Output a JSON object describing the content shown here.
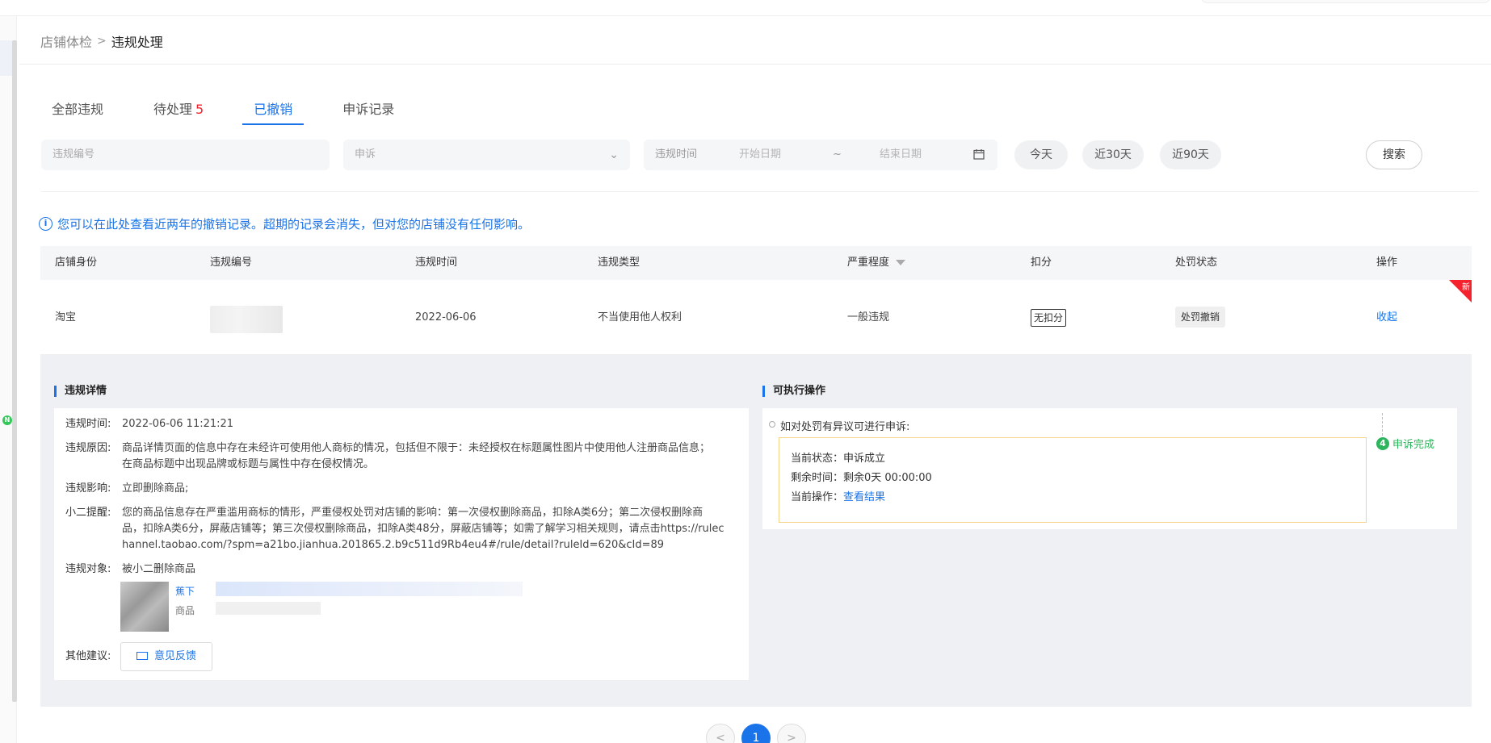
{
  "breadcrumb": {
    "parent": "店铺体检",
    "separator": ">",
    "current": "违规处理"
  },
  "tabs": [
    {
      "label": "全部违规",
      "count": ""
    },
    {
      "label": "待处理",
      "count": "5"
    },
    {
      "label": "已撤销",
      "count": ""
    },
    {
      "label": "申诉记录",
      "count": ""
    }
  ],
  "filters": {
    "id_placeholder": "违规编号",
    "select_value": "申诉",
    "date_label": "违规时间",
    "start_placeholder": "开始日期",
    "tilde": "~",
    "end_placeholder": "结束日期",
    "chip_today": "今天",
    "chip_30": "近30天",
    "chip_90": "近90天",
    "search_label": "搜索"
  },
  "notice": "您可以在此处查看近两年的撤销记录。超期的记录会消失，但对您的店铺没有任何影响。",
  "table": {
    "headers": [
      "店铺身份",
      "违规编号",
      "违规时间",
      "违规类型",
      "严重程度",
      "扣分",
      "处罚状态",
      "操作"
    ],
    "row": {
      "identity": "淘宝",
      "time": "2022-06-06",
      "type": "不当使用他人权利",
      "severity": "一般违规",
      "deduction": "无扣分",
      "status": "处罚撤销",
      "action": "收起",
      "new_badge": "新"
    }
  },
  "detail": {
    "section_title": "违规详情",
    "time_k": "违规时间:",
    "time_v": "2022-06-06 11:21:21",
    "reason_k": "违规原因:",
    "reason_v1": "商品详情页面的信息中存在未经许可使用他人商标的情况，包括但不限于：未经授权在标题属性图片中使用他人注册商品信息；",
    "reason_v2": "在商品标题中出现品牌或标题与属性中存在侵权情况。",
    "impact_k": "违规影响:",
    "impact_v": "立即删除商品;",
    "tip_k": "小二提醒:",
    "tip_v1": "您的商品信息存在严重滥用商标的情形，严重侵权处罚对店铺的影响：第一次侵权删除商品，扣除A类6分；第二次侵权删除商",
    "tip_v2": "品，扣除A类6分，屏蔽店铺等；第三次侵权删除商品，扣除A类48分，屏蔽店铺等；如需了解学习相关规则，请点击https://rulec",
    "tip_v3": "hannel.taobao.com/?spm=a21bo.jianhua.201865.2.b9c511d9Rb4eu4#/rule/detail?ruleId=620&cId=89",
    "target_k": "违规对象:",
    "target_v": "被小二删除商品",
    "item_lbl1": "蕉下",
    "item_lbl2": "商品",
    "other_k": "其他建议:",
    "feedback_label": "意见反馈"
  },
  "actions": {
    "section_title": "可执行操作",
    "title": "如对处罚有异议可进行申诉:",
    "status_line": "当前状态：申诉成立",
    "remain_line": "剩余时间：剩余0天 00:00:00",
    "op_prefix": "当前操作：",
    "op_link": "查看结果",
    "step_num": "4",
    "step_label": "申诉完成"
  },
  "pagination": {
    "prev": "<",
    "current": "1",
    "next": ">"
  },
  "colors": {
    "accent": "#1a73e8",
    "danger": "#f5222d",
    "success": "#2db55d"
  }
}
